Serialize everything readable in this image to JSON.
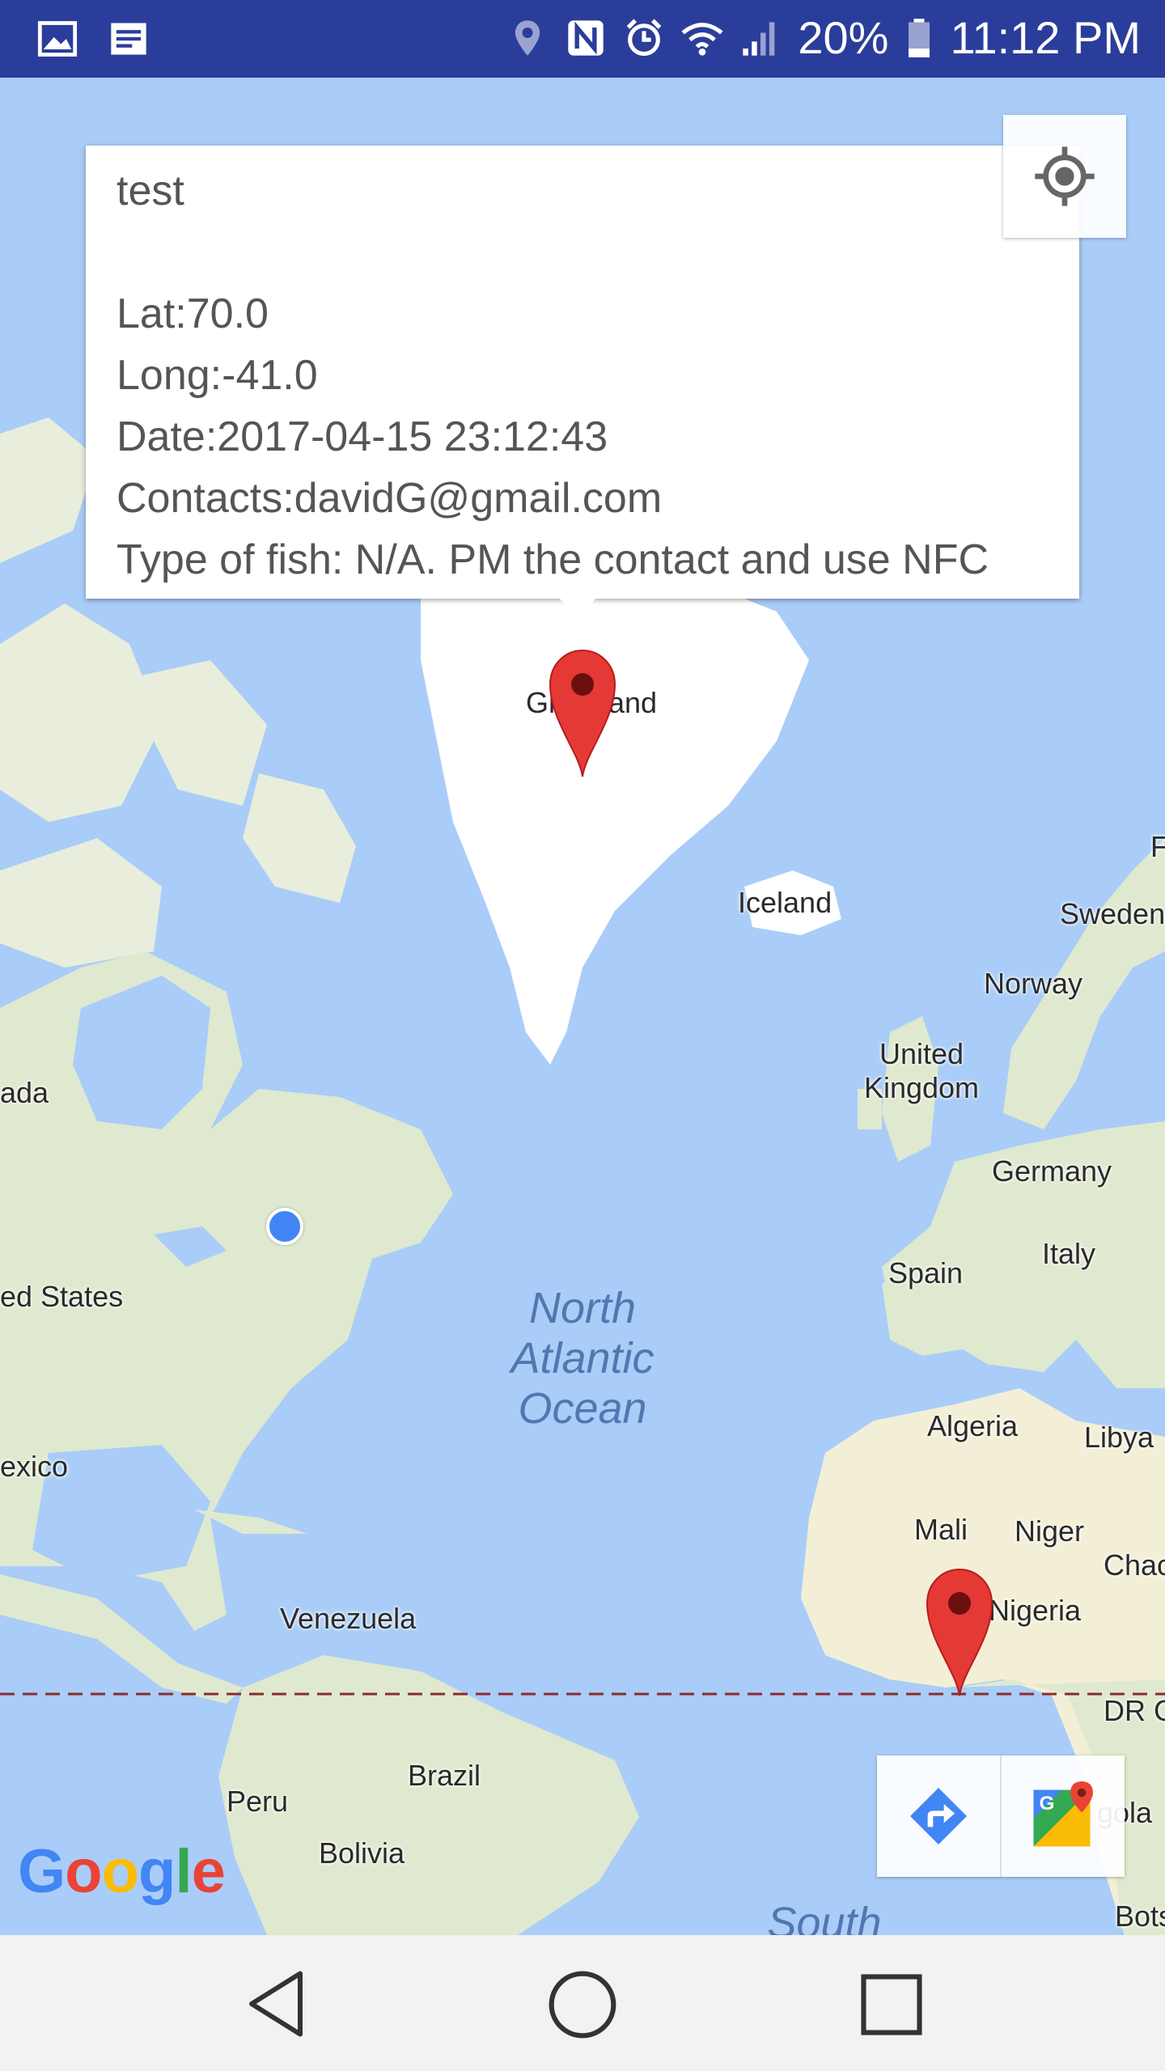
{
  "status_bar": {
    "battery_percent": "20%",
    "time": "11:12 PM",
    "icons": [
      "gallery-icon",
      "notes-icon",
      "location-icon",
      "nfc-icon",
      "alarm-icon",
      "wifi-icon",
      "signal-icon",
      "battery-icon"
    ]
  },
  "info_window": {
    "title": "test",
    "lat": "Lat:70.0",
    "long": "Long:-41.0",
    "date": "Date:2017-04-15 23:12:43",
    "contacts": "Contacts:davidG@gmail.com",
    "type_of_fish": "Type of fish: N/A. PM the contact and use NFC"
  },
  "map": {
    "labels": {
      "greenland_left": "Gr",
      "greenland_right": "and",
      "iceland": "Iceland",
      "sweden": "Sweden",
      "norway": "Norway",
      "uk": "United Kingdom",
      "canada": "ada",
      "germany": "Germany",
      "italy": "Italy",
      "spain": "Spain",
      "united_states": "ed States",
      "algeria": "Algeria",
      "libya": "Libya",
      "mexico": "exico",
      "mali": "Mali",
      "niger": "Niger",
      "chad": "Chac",
      "nigeria": "Nigeria",
      "venezuela": "Venezuela",
      "dr_congo": "DR C",
      "brazil": "Brazil",
      "peru": "Peru",
      "angola": "gola",
      "bolivia": "Bolivia",
      "botswana": "Bots",
      "finland_edge": "F",
      "ocean_line1": "North",
      "ocean_line2": "Atlantic",
      "ocean_line3": "Ocean",
      "south": "South"
    },
    "google_logo": "Google",
    "colors": {
      "water": "#a9cdf8",
      "land": "#e8eedb",
      "ice": "#ffffff",
      "marker": "#e53935",
      "user_location": "#4285f4",
      "equator": "#8b2b2b"
    }
  },
  "controls": {
    "my_location": "my-location-icon",
    "directions": "directions-icon",
    "open_maps": "google-maps-icon"
  },
  "nav_bar": {
    "back": "back-icon",
    "home": "home-icon",
    "recents": "recents-icon"
  }
}
